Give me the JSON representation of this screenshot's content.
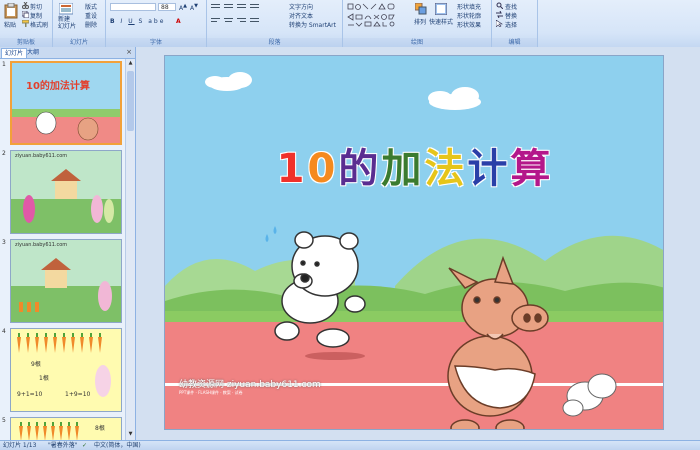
{
  "ribbon": {
    "clipboard": {
      "paste": "粘贴",
      "cut": "剪切",
      "copy": "复制",
      "format_painter": "格式刷",
      "label": "剪贴板"
    },
    "slides": {
      "new_slide": "新建\n幻灯片",
      "layout": "版式",
      "reset": "重设",
      "delete": "删除",
      "label": "幻灯片"
    },
    "font": {
      "font_name": "",
      "font_size": "88",
      "label": "字体"
    },
    "paragraph": {
      "text_direction": "文字方向",
      "align_text": "对齐文本",
      "convert_smartart": "转换为 SmartArt",
      "label": "段落"
    },
    "drawing": {
      "arrange": "排列",
      "quick_styles": "快速样式",
      "shape_fill": "形状填充",
      "shape_outline": "形状轮廓",
      "shape_effects": "形状效果",
      "label": "绘图"
    },
    "editing": {
      "find": "查找",
      "replace": "替换",
      "select": "选择",
      "label": "编辑"
    }
  },
  "panel": {
    "tab_slides": "幻灯片",
    "tab_outline": "大纲",
    "close": "×",
    "thumbnails": [
      {
        "num": "1",
        "title": "10的加法计算"
      },
      {
        "num": "2",
        "title": "ziyuan.baby611.com"
      },
      {
        "num": "3",
        "title": "ziyuan.baby611.com"
      },
      {
        "num": "4",
        "title": "",
        "text1": "9根",
        "text2": "1根",
        "eq1": "9+1=10",
        "eq2": "1+9=10"
      },
      {
        "num": "5",
        "title": "",
        "text1": "8根"
      }
    ]
  },
  "slide": {
    "title_chars": [
      "1",
      "0",
      "的",
      "加",
      "法",
      "计",
      "算"
    ],
    "title_colors": [
      "#f0312b",
      "#f58a1f",
      "#5a2d91",
      "#3b7b2f",
      "#e6c51a",
      "#2a3fa8",
      "#b4178a"
    ],
    "watermark": "幼教资源网 ziyuan.baby611.com",
    "watermark_sub": "PPT课件 · FLASH课件 · 教案 · 试卷",
    "colors": {
      "sky": "#8ed0ee",
      "track": "#f08282",
      "grass": "#8dc96b"
    }
  },
  "status": {
    "slide_counter": "幻灯片 1/13",
    "theme": "\"暑春外落\"",
    "language": "中文(简体，中国)"
  }
}
